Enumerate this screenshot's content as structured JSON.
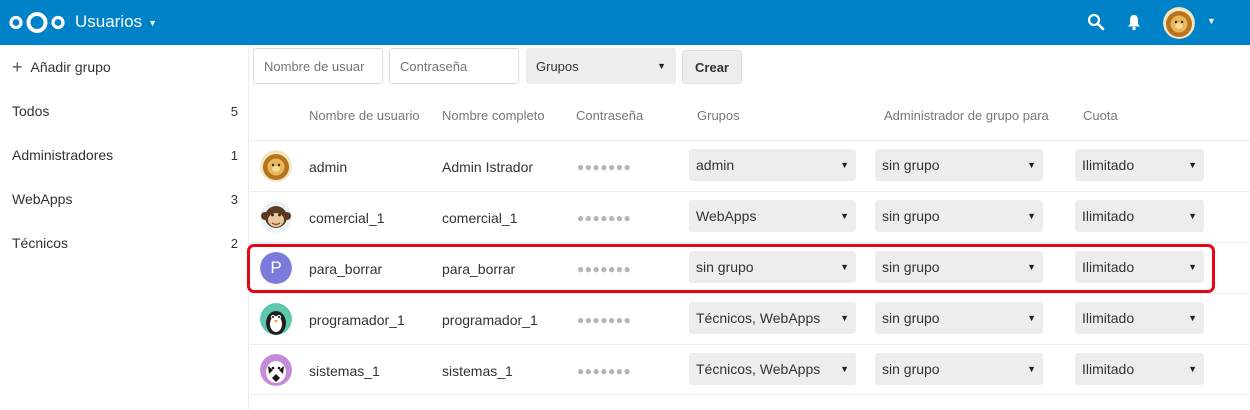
{
  "header": {
    "app_name": "Usuarios",
    "icons": [
      "nextcloud-logo",
      "search-icon",
      "bell-icon",
      "avatar",
      "chevron-down-icon"
    ],
    "color": "#0082c9"
  },
  "sidebar": {
    "add_group": "Añadir grupo",
    "items": [
      {
        "label": "Todos",
        "count": "5"
      },
      {
        "label": "Administradores",
        "count": "1"
      },
      {
        "label": "WebApps",
        "count": "3"
      },
      {
        "label": "Técnicos",
        "count": "2"
      }
    ]
  },
  "create": {
    "username_placeholder": "Nombre de usuar",
    "password_placeholder": "Contraseña",
    "groups_label": "Grupos",
    "create_label": "Crear"
  },
  "table": {
    "headers": [
      "Nombre de usuario",
      "Nombre completo",
      "Contraseña",
      "Grupos",
      "Administrador de grupo para",
      "Cuota"
    ],
    "rows": [
      {
        "username": "admin",
        "fullname": "Admin Istrador",
        "password": "●●●●●●●",
        "groups": "admin",
        "subadmin": "sin grupo",
        "quota": "Ilimitado"
      },
      {
        "username": "comercial_1",
        "fullname": "comercial_1",
        "password": "●●●●●●●",
        "groups": "WebApps",
        "subadmin": "sin grupo",
        "quota": "Ilimitado"
      },
      {
        "username": "para_borrar",
        "fullname": "para_borrar",
        "password": "●●●●●●●",
        "groups": "sin grupo",
        "subadmin": "sin grupo",
        "quota": "Ilimitado",
        "avatar_letter": "P"
      },
      {
        "username": "programador_1",
        "fullname": "programador_1",
        "password": "●●●●●●●",
        "groups": "Técnicos, WebApps",
        "subadmin": "sin grupo",
        "quota": "Ilimitado"
      },
      {
        "username": "sistemas_1",
        "fullname": "sistemas_1",
        "password": "●●●●●●●",
        "groups": "Técnicos, WebApps",
        "subadmin": "sin grupo",
        "quota": "Ilimitado"
      }
    ]
  },
  "highlight_color": "#e30613"
}
